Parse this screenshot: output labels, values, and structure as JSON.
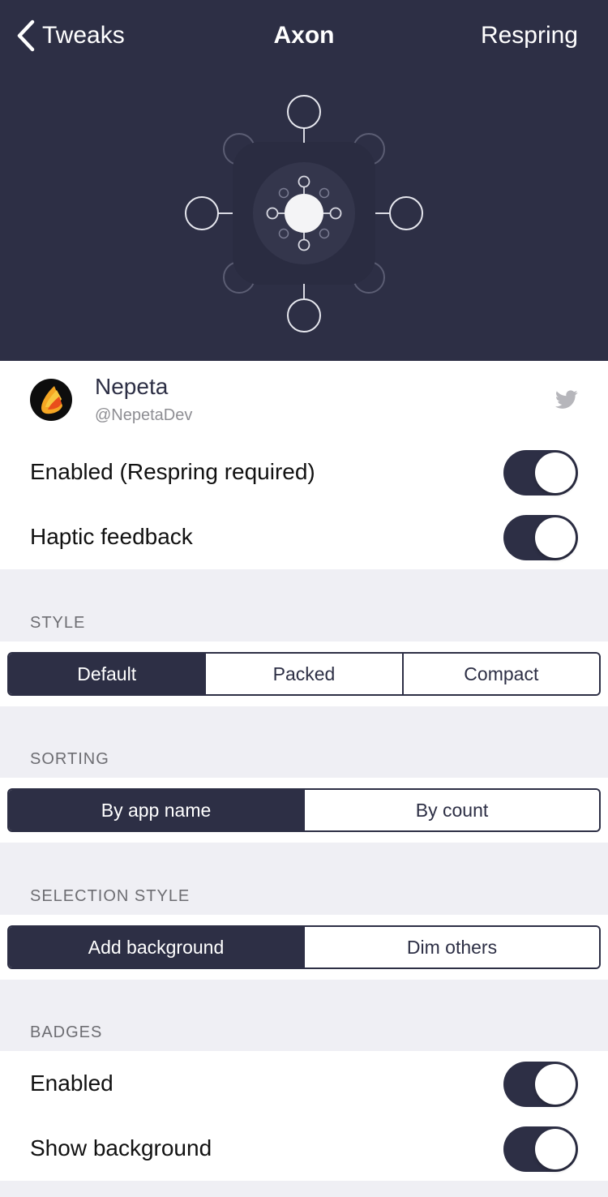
{
  "nav": {
    "back_label": "Tweaks",
    "title": "Axon",
    "right_action": "Respring"
  },
  "colors": {
    "header_bg": "#2d2f45",
    "accent": "#2d2f45",
    "page_bg": "#efeff4",
    "toggle_on": "#2d2f45"
  },
  "author": {
    "name": "Nepeta",
    "handle": "@NepetaDev",
    "icon": "twitter-icon"
  },
  "general": {
    "enabled_label": "Enabled (Respring required)",
    "enabled_value": true,
    "haptic_label": "Haptic feedback",
    "haptic_value": true
  },
  "style": {
    "header": "STYLE",
    "options": [
      "Default",
      "Packed",
      "Compact"
    ],
    "selected": "Default"
  },
  "sorting": {
    "header": "SORTING",
    "options": [
      "By app name",
      "By count"
    ],
    "selected": "By app name"
  },
  "selection_style": {
    "header": "SELECTION STYLE",
    "options": [
      "Add background",
      "Dim others"
    ],
    "selected": "Add background"
  },
  "badges": {
    "header": "BADGES",
    "enabled_label": "Enabled",
    "enabled_value": true,
    "show_background_label": "Show background",
    "show_background_value": true
  }
}
